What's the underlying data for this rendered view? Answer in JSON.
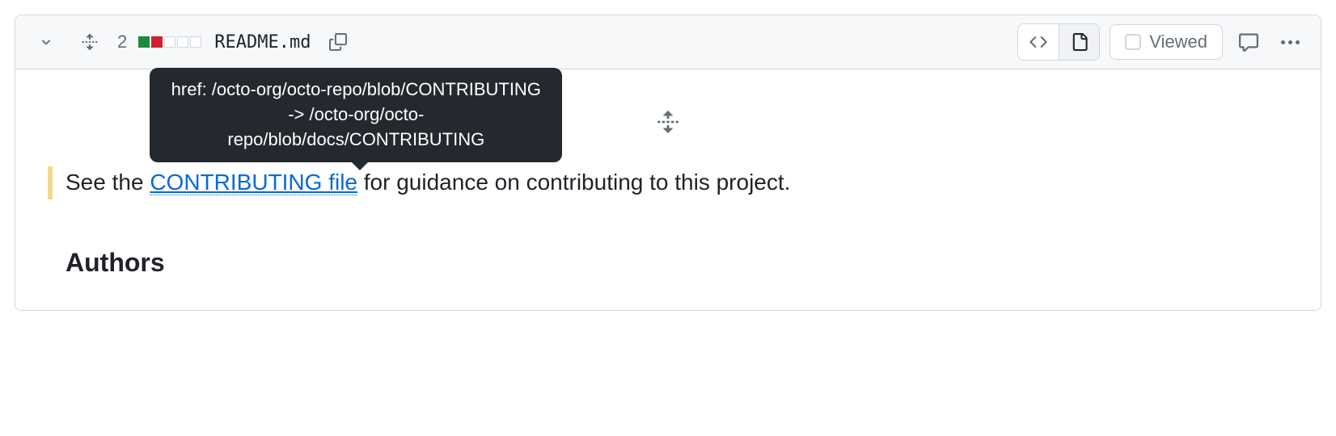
{
  "header": {
    "change_count": "2",
    "filename": "README.md",
    "viewed_label": "Viewed"
  },
  "body": {
    "line_prefix": "See the ",
    "link_text": "CONTRIBUTING file",
    "line_suffix": " for guidance on contributing to this project.",
    "tooltip": "href: /octo-org/octo-repo/blob/CONTRIBUTING -> /octo-org/octo-repo/blob/docs/CONTRIBUTING",
    "heading": "Authors"
  }
}
